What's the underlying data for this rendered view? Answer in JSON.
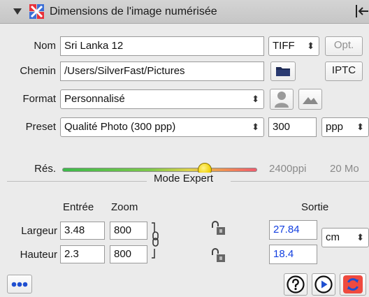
{
  "header": {
    "title": "Dimensions de l'image numérisée"
  },
  "row_nom": {
    "label": "Nom",
    "value": "Sri Lanka 12",
    "format": "TIFF",
    "opt_label": "Opt."
  },
  "row_chemin": {
    "label": "Chemin",
    "value": "/Users/SilverFast/Pictures",
    "iptc_label": "IPTC"
  },
  "row_format": {
    "label": "Format",
    "value": "Personnalisé"
  },
  "row_preset": {
    "label": "Preset",
    "value": "Qualité Photo (300 ppp)",
    "dpi": "300",
    "unit": "ppp"
  },
  "row_res": {
    "label": "Rés.",
    "slider_fraction": 0.73,
    "ppi_readout": "2400ppi",
    "size_readout": "20 Mo"
  },
  "expert": {
    "title": "Mode Expert",
    "col_entree": "Entrée",
    "col_zoom": "Zoom",
    "col_sortie": "Sortie",
    "largeur_label": "Largeur",
    "largeur_in": "3.48",
    "largeur_zoom": "800",
    "largeur_out": "27.84",
    "hauteur_label": "Hauteur",
    "hauteur_in": "2.3",
    "hauteur_zoom": "800",
    "hauteur_out": "18.4",
    "out_unit": "cm"
  },
  "colors": {
    "accent_blue": "#1440e0",
    "logo_red": "#e8323a",
    "logo_blue": "#3d6fd6"
  }
}
